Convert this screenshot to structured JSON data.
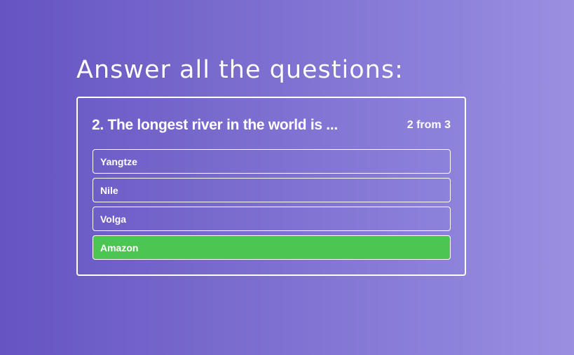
{
  "page": {
    "title": "Answer all the questions:"
  },
  "quiz": {
    "question": "2. The longest river in the world is ...",
    "counter": "2 from 3",
    "answers": [
      {
        "label": "Yangtze",
        "state": "default"
      },
      {
        "label": "Nile",
        "state": "default"
      },
      {
        "label": "Volga",
        "state": "default"
      },
      {
        "label": "Amazon",
        "state": "correct"
      }
    ]
  },
  "colors": {
    "background_start": "#6554c2",
    "background_end": "#9a8fe0",
    "correct_answer": "#4cc552",
    "border": "#ffffff"
  }
}
